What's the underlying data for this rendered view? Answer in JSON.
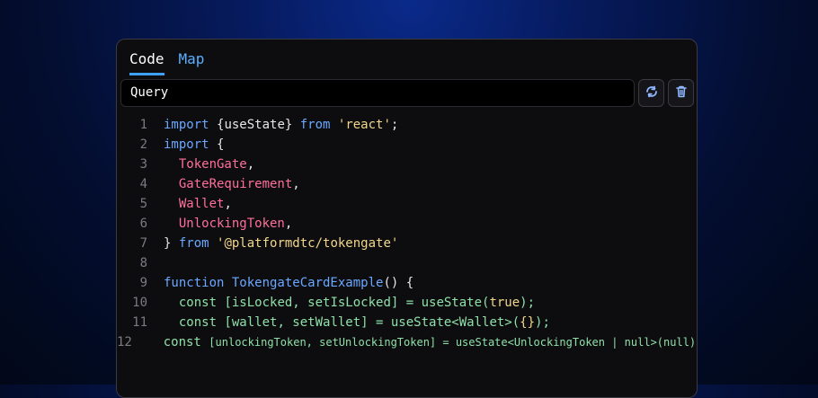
{
  "tabs": [
    {
      "label": "Code",
      "active": true
    },
    {
      "label": "Map",
      "active": false
    }
  ],
  "query": {
    "label": "Query"
  },
  "actions": {
    "refresh_icon": "refresh-cycle-icon",
    "delete_icon": "trash-icon"
  },
  "code_lines": [
    {
      "n": "1",
      "tokens": [
        {
          "t": "import ",
          "c": "kw"
        },
        {
          "t": "{useState} ",
          "c": ""
        },
        {
          "t": "from ",
          "c": "kw"
        },
        {
          "t": "'react'",
          "c": "str"
        },
        {
          "t": ";",
          "c": ""
        }
      ]
    },
    {
      "n": "2",
      "tokens": [
        {
          "t": "import ",
          "c": "kw"
        },
        {
          "t": "{",
          "c": ""
        }
      ]
    },
    {
      "n": "3",
      "tokens": [
        {
          "t": "  ",
          "c": ""
        },
        {
          "t": "TokenGate",
          "c": "id"
        },
        {
          "t": ",",
          "c": ""
        }
      ]
    },
    {
      "n": "4",
      "tokens": [
        {
          "t": "  ",
          "c": ""
        },
        {
          "t": "GateRequirement",
          "c": "id"
        },
        {
          "t": ",",
          "c": ""
        }
      ]
    },
    {
      "n": "5",
      "tokens": [
        {
          "t": "  ",
          "c": ""
        },
        {
          "t": "Wallet",
          "c": "id"
        },
        {
          "t": ",",
          "c": ""
        }
      ]
    },
    {
      "n": "6",
      "tokens": [
        {
          "t": "  ",
          "c": ""
        },
        {
          "t": "UnlockingToken",
          "c": "id"
        },
        {
          "t": ",",
          "c": ""
        }
      ]
    },
    {
      "n": "7",
      "tokens": [
        {
          "t": "} ",
          "c": ""
        },
        {
          "t": "from ",
          "c": "kw"
        },
        {
          "t": "'@platformdtc/tokengate'",
          "c": "str"
        }
      ]
    },
    {
      "n": "8",
      "tokens": []
    },
    {
      "n": "9",
      "tokens": [
        {
          "t": "function ",
          "c": "kw"
        },
        {
          "t": "TokengateCardExample",
          "c": "fn"
        },
        {
          "t": "() {",
          "c": ""
        }
      ]
    },
    {
      "n": "10",
      "tokens": [
        {
          "t": "  const ",
          "c": "grn"
        },
        {
          "t": "[isLocked, setIsLocked] = useState(",
          "c": "grn"
        },
        {
          "t": "true",
          "c": "str"
        },
        {
          "t": ");",
          "c": "grn"
        }
      ]
    },
    {
      "n": "11",
      "tokens": [
        {
          "t": "  const ",
          "c": "grn"
        },
        {
          "t": "[wallet, setWallet] = useState<Wallet>(",
          "c": "grn"
        },
        {
          "t": "{}",
          "c": "str"
        },
        {
          "t": ");",
          "c": "grn"
        }
      ]
    },
    {
      "n": "12",
      "tokens": [
        {
          "t": "  const ",
          "c": "grn"
        },
        {
          "t": "[unlockingToken, setUnlockingToken] = useState<UnlockingToken | null>(null);",
          "c": "grn small"
        }
      ]
    }
  ]
}
